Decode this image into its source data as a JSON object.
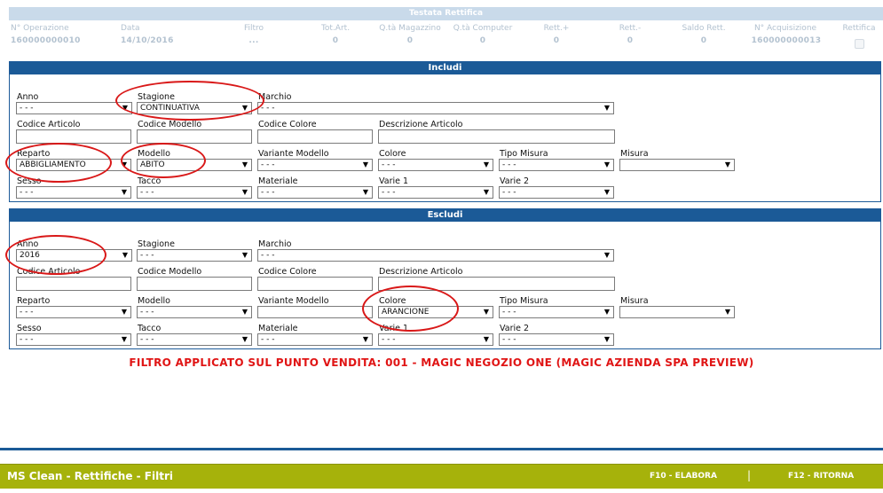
{
  "header": {
    "title": "Testata Rettifica",
    "columns": [
      {
        "label": "N° Operazione",
        "value": "160000000010"
      },
      {
        "label": "Data",
        "value": "14/10/2016"
      },
      {
        "label": "Filtro",
        "value": "..."
      },
      {
        "label": "Tot.Art.",
        "value": "0"
      },
      {
        "label": "Q.tà Magazzino",
        "value": "0"
      },
      {
        "label": "Q.tà Computer",
        "value": "0"
      },
      {
        "label": "Rett.+",
        "value": "0"
      },
      {
        "label": "Rett.-",
        "value": "0"
      },
      {
        "label": "Saldo Rett.",
        "value": "0"
      },
      {
        "label": "N° Acquisizione",
        "value": "160000000013"
      },
      {
        "label": "Rettifica",
        "value": ""
      }
    ]
  },
  "includi": {
    "title": "Includi",
    "anno": {
      "label": "Anno",
      "value": "- - -"
    },
    "stagione": {
      "label": "Stagione",
      "value": "CONTINUATIVA"
    },
    "marchio": {
      "label": "Marchio",
      "value": "- - -"
    },
    "codice_articolo": {
      "label": "Codice Articolo",
      "value": ""
    },
    "codice_modello": {
      "label": "Codice Modello",
      "value": ""
    },
    "codice_colore": {
      "label": "Codice Colore",
      "value": ""
    },
    "descrizione_articolo": {
      "label": "Descrizione Articolo",
      "value": ""
    },
    "reparto": {
      "label": "Reparto",
      "value": "ABBIGLIAMENTO"
    },
    "modello": {
      "label": "Modello",
      "value": "ABITO"
    },
    "variante_modello": {
      "label": "Variante Modello",
      "value": "- - -"
    },
    "colore": {
      "label": "Colore",
      "value": "- - -"
    },
    "tipo_misura": {
      "label": "Tipo Misura",
      "value": "- - -"
    },
    "misura": {
      "label": "Misura",
      "value": ""
    },
    "sesso": {
      "label": "Sesso",
      "value": "- - -"
    },
    "tacco": {
      "label": "Tacco",
      "value": "- - -"
    },
    "materiale": {
      "label": "Materiale",
      "value": "- - -"
    },
    "varie1": {
      "label": "Varie 1",
      "value": "- - -"
    },
    "varie2": {
      "label": "Varie 2",
      "value": "- - -"
    }
  },
  "escludi": {
    "title": "Escludi",
    "anno": {
      "label": "Anno",
      "value": "2016"
    },
    "stagione": {
      "label": "Stagione",
      "value": "- - -"
    },
    "marchio": {
      "label": "Marchio",
      "value": "- - -"
    },
    "codice_articolo": {
      "label": "Codice Articolo",
      "value": ""
    },
    "codice_modello": {
      "label": "Codice Modello",
      "value": ""
    },
    "codice_colore": {
      "label": "Codice Colore",
      "value": ""
    },
    "descrizione_articolo": {
      "label": "Descrizione Articolo",
      "value": ""
    },
    "reparto": {
      "label": "Reparto",
      "value": "- - -"
    },
    "modello": {
      "label": "Modello",
      "value": "- - -"
    },
    "variante_modello": {
      "label": "Variante Modello",
      "value": ""
    },
    "colore": {
      "label": "Colore",
      "value": "ARANCIONE"
    },
    "tipo_misura": {
      "label": "Tipo Misura",
      "value": "- - -"
    },
    "misura": {
      "label": "Misura",
      "value": ""
    },
    "sesso": {
      "label": "Sesso",
      "value": "- - -"
    },
    "tacco": {
      "label": "Tacco",
      "value": "- - -"
    },
    "materiale": {
      "label": "Materiale",
      "value": "- - -"
    },
    "varie1": {
      "label": "Varie 1",
      "value": "- - -"
    },
    "varie2": {
      "label": "Varie 2",
      "value": "- - -"
    }
  },
  "notice": "FILTRO APPLICATO SUL PUNTO VENDITA: 001 - MAGIC NEGOZIO ONE (MAGIC AZIENDA SPA PREVIEW)",
  "footer": {
    "title": "MS Clean - Rettifiche - Filtri",
    "f10": "F10 - ELABORA",
    "separator": "|",
    "f12": "F12 - RITORNA"
  },
  "colors": {
    "section_header": "#1b5a97",
    "footer_bg": "#a6b20b",
    "notice": "#e01515",
    "annotation": "#d91818"
  }
}
